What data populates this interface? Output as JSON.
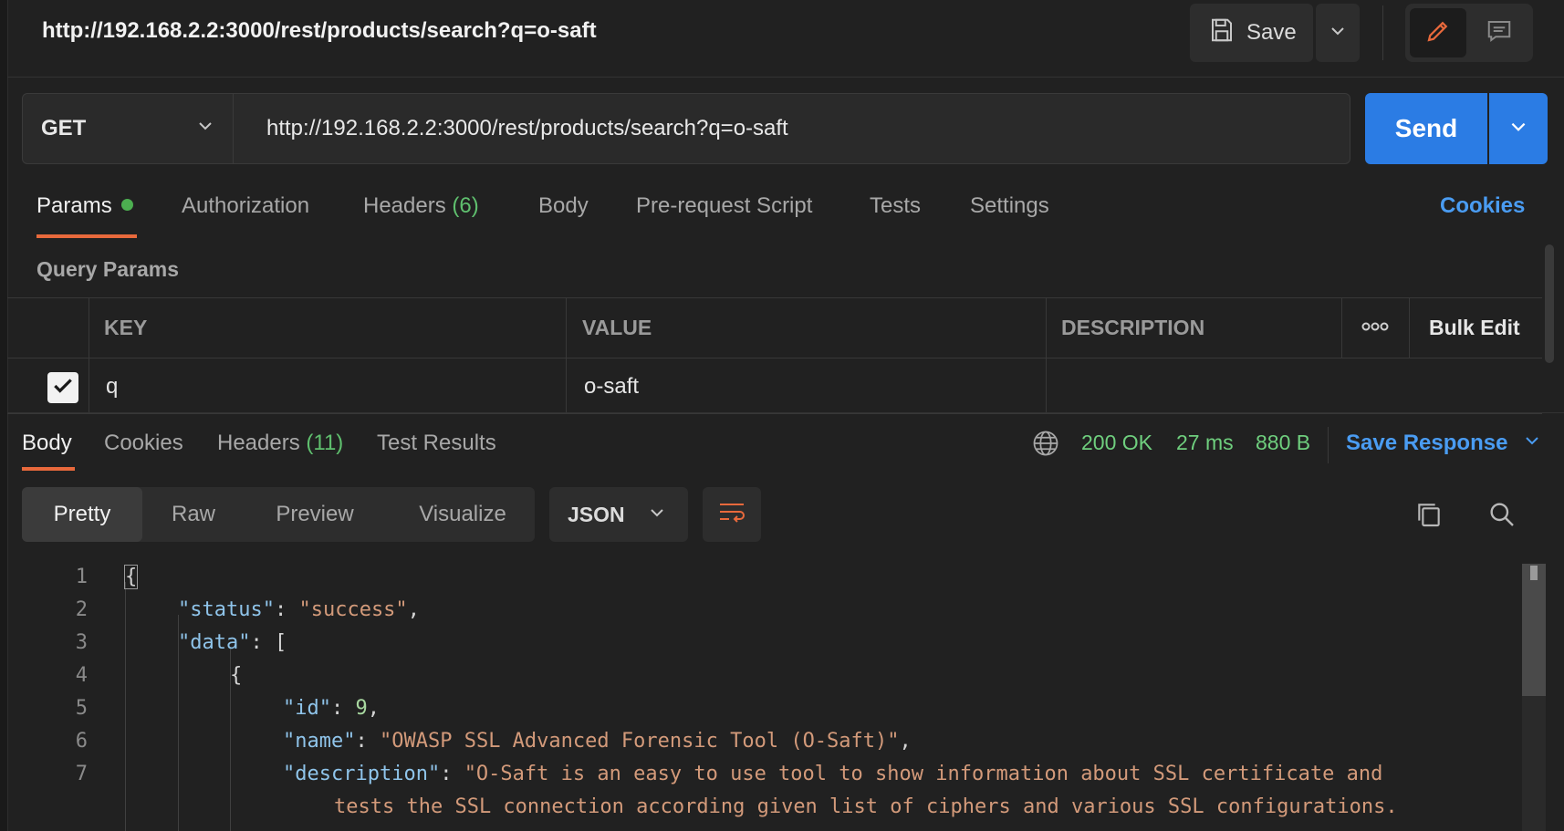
{
  "request": {
    "title": "http://192.168.2.2:3000/rest/products/search?q=o-saft",
    "save_label": "Save",
    "method": "GET",
    "url": "http://192.168.2.2:3000/rest/products/search?q=o-saft",
    "send_label": "Send"
  },
  "request_tabs": {
    "params": "Params",
    "authorization": "Authorization",
    "headers": "Headers",
    "headers_count": "(6)",
    "body": "Body",
    "prerequest": "Pre-request Script",
    "tests": "Tests",
    "settings": "Settings",
    "cookies": "Cookies"
  },
  "query_params": {
    "label": "Query Params",
    "columns": {
      "key": "KEY",
      "value": "VALUE",
      "description": "DESCRIPTION",
      "bulk_edit": "Bulk Edit"
    },
    "rows": [
      {
        "key": "q",
        "value": "o-saft",
        "description": "",
        "checked": true
      }
    ]
  },
  "response": {
    "tabs": {
      "body": "Body",
      "cookies": "Cookies",
      "headers": "Headers",
      "headers_count": "(11)",
      "test_results": "Test Results"
    },
    "status": "200 OK",
    "time": "27 ms",
    "size": "880 B",
    "save_response": "Save Response",
    "views": {
      "pretty": "Pretty",
      "raw": "Raw",
      "preview": "Preview",
      "visualize": "Visualize"
    },
    "format": "JSON"
  },
  "code": {
    "line_numbers": [
      "1",
      "2",
      "3",
      "4",
      "5",
      "6",
      "7"
    ],
    "open_brace": "{",
    "status_key": "\"status\"",
    "status_value": "\"success\"",
    "data_key": "\"data\"",
    "inner_brace": "{",
    "id_key": "\"id\"",
    "id_value": "9",
    "name_key": "\"name\"",
    "name_value": "\"OWASP SSL Advanced Forensic Tool (O-Saft)\"",
    "desc_key": "\"description\"",
    "desc_value_1": "\"O-Saft is an easy to use tool to show information about SSL certificate and",
    "desc_value_2": "tests the SSL connection according given list of ciphers and various SSL configurations."
  },
  "colors": {
    "accent_orange": "#e8693c",
    "send_blue": "#2b7ce4",
    "link_blue": "#4a9cf2",
    "status_green": "#6fcf7e"
  },
  "icons": [
    "save-icon",
    "chevron-down-icon",
    "pencil-icon",
    "comment-icon",
    "globe-icon",
    "wrap-lines-icon",
    "copy-icon",
    "search-icon",
    "checkmark-icon",
    "more-icon"
  ]
}
